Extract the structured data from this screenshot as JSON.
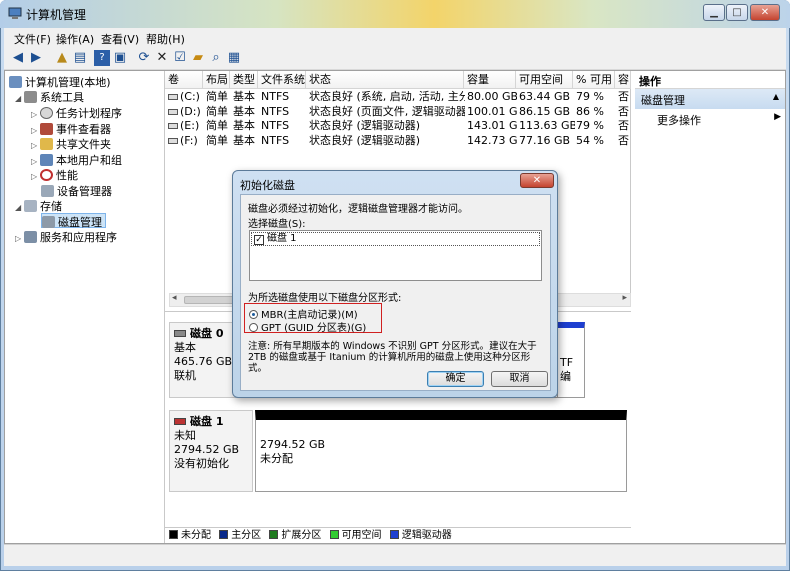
{
  "window": {
    "title": "计算机管理",
    "min": "▁",
    "max": "□",
    "close": "✕"
  },
  "menu": [
    "文件(F)",
    "操作(A)",
    "查看(V)",
    "帮助(H)"
  ],
  "tree": {
    "root": "计算机管理(本地)",
    "system_tools": "系统工具",
    "task_scheduler": "任务计划程序",
    "event_viewer": "事件查看器",
    "shared_folders": "共享文件夹",
    "local_users": "本地用户和组",
    "performance": "性能",
    "device_manager": "设备管理器",
    "storage": "存储",
    "disk_management": "磁盘管理",
    "services_apps": "服务和应用程序"
  },
  "volume_list": {
    "headers": [
      "卷",
      "布局",
      "类型",
      "文件系统",
      "状态",
      "容量",
      "可用空间",
      "% 可用",
      "容"
    ],
    "rows": [
      [
        "(C:)",
        "简单",
        "基本",
        "NTFS",
        "状态良好 (系统, 启动, 活动, 主分区)",
        "80.00 GB",
        "63.44 GB",
        "79 %",
        "否"
      ],
      [
        "(D:)",
        "简单",
        "基本",
        "NTFS",
        "状态良好 (页面文件, 逻辑驱动器)",
        "100.01 GB",
        "86.15 GB",
        "86 %",
        "否"
      ],
      [
        "(E:)",
        "简单",
        "基本",
        "NTFS",
        "状态良好 (逻辑驱动器)",
        "143.01 GB",
        "113.63 GB",
        "79 %",
        "否"
      ],
      [
        "(F:)",
        "简单",
        "基本",
        "NTFS",
        "状态良好 (逻辑驱动器)",
        "142.73 GB",
        "77.16 GB",
        "54 %",
        "否"
      ]
    ]
  },
  "disk0": {
    "name": "磁盘 0",
    "type": "基本",
    "size": "465.76 GB",
    "status": "联机",
    "frag1": "TF",
    "frag2": "编"
  },
  "disk1": {
    "name": "磁盘 1",
    "type": "未知",
    "size": "2794.52 GB",
    "status": "没有初始化",
    "part_size": "2794.52 GB",
    "part_status": "未分配"
  },
  "legend": [
    "未分配",
    "主分区",
    "扩展分区",
    "可用空间",
    "逻辑驱动器"
  ],
  "legend_colors": [
    "#000000",
    "#0a2a8a",
    "#1f7a1f",
    "#33cc33",
    "#1e3fd0"
  ],
  "actions": {
    "header": "操作",
    "section": "磁盘管理",
    "more": "更多操作"
  },
  "dialog": {
    "title": "初始化磁盘",
    "intro": "磁盘必须经过初始化，逻辑磁盘管理器才能访问。",
    "select_label": "选择磁盘(S):",
    "disk_item": "磁盘 1",
    "style_label": "为所选磁盘使用以下磁盘分区形式:",
    "mbr": "MBR(主启动记录)(M)",
    "gpt": "GPT (GUID 分区表)(G)",
    "note1": "注意: 所有早期版本的 Windows 不识别 GPT 分区形式。建议在大于",
    "note2": "2TB 的磁盘或基于 Itanium 的计算机所用的磁盘上使用这种分区形",
    "note3": "式。",
    "ok": "确定",
    "cancel": "取消"
  }
}
